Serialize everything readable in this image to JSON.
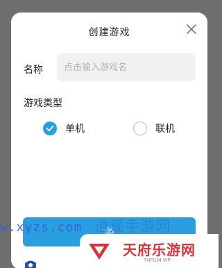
{
  "dialog": {
    "title": "创建游戏",
    "close_icon": "close-icon",
    "name_label": "名称",
    "name_input": {
      "value": "",
      "placeholder": "点击输入游戏名"
    },
    "type_label": "游戏类型",
    "options": [
      {
        "label": "单机",
        "selected": true
      },
      {
        "label": "联机",
        "selected": false
      }
    ],
    "confirm_label": "创"
  },
  "watermark": {
    "site_text": "w.xyzs.com",
    "site_cn": "逍遥手游网",
    "logo_name": "天府乐游网",
    "logo_sub": "THFILM VIP"
  },
  "colors": {
    "accent": "#2a9fe0",
    "overlay": "#6f6f6f",
    "logo_red": "#d6333a"
  }
}
